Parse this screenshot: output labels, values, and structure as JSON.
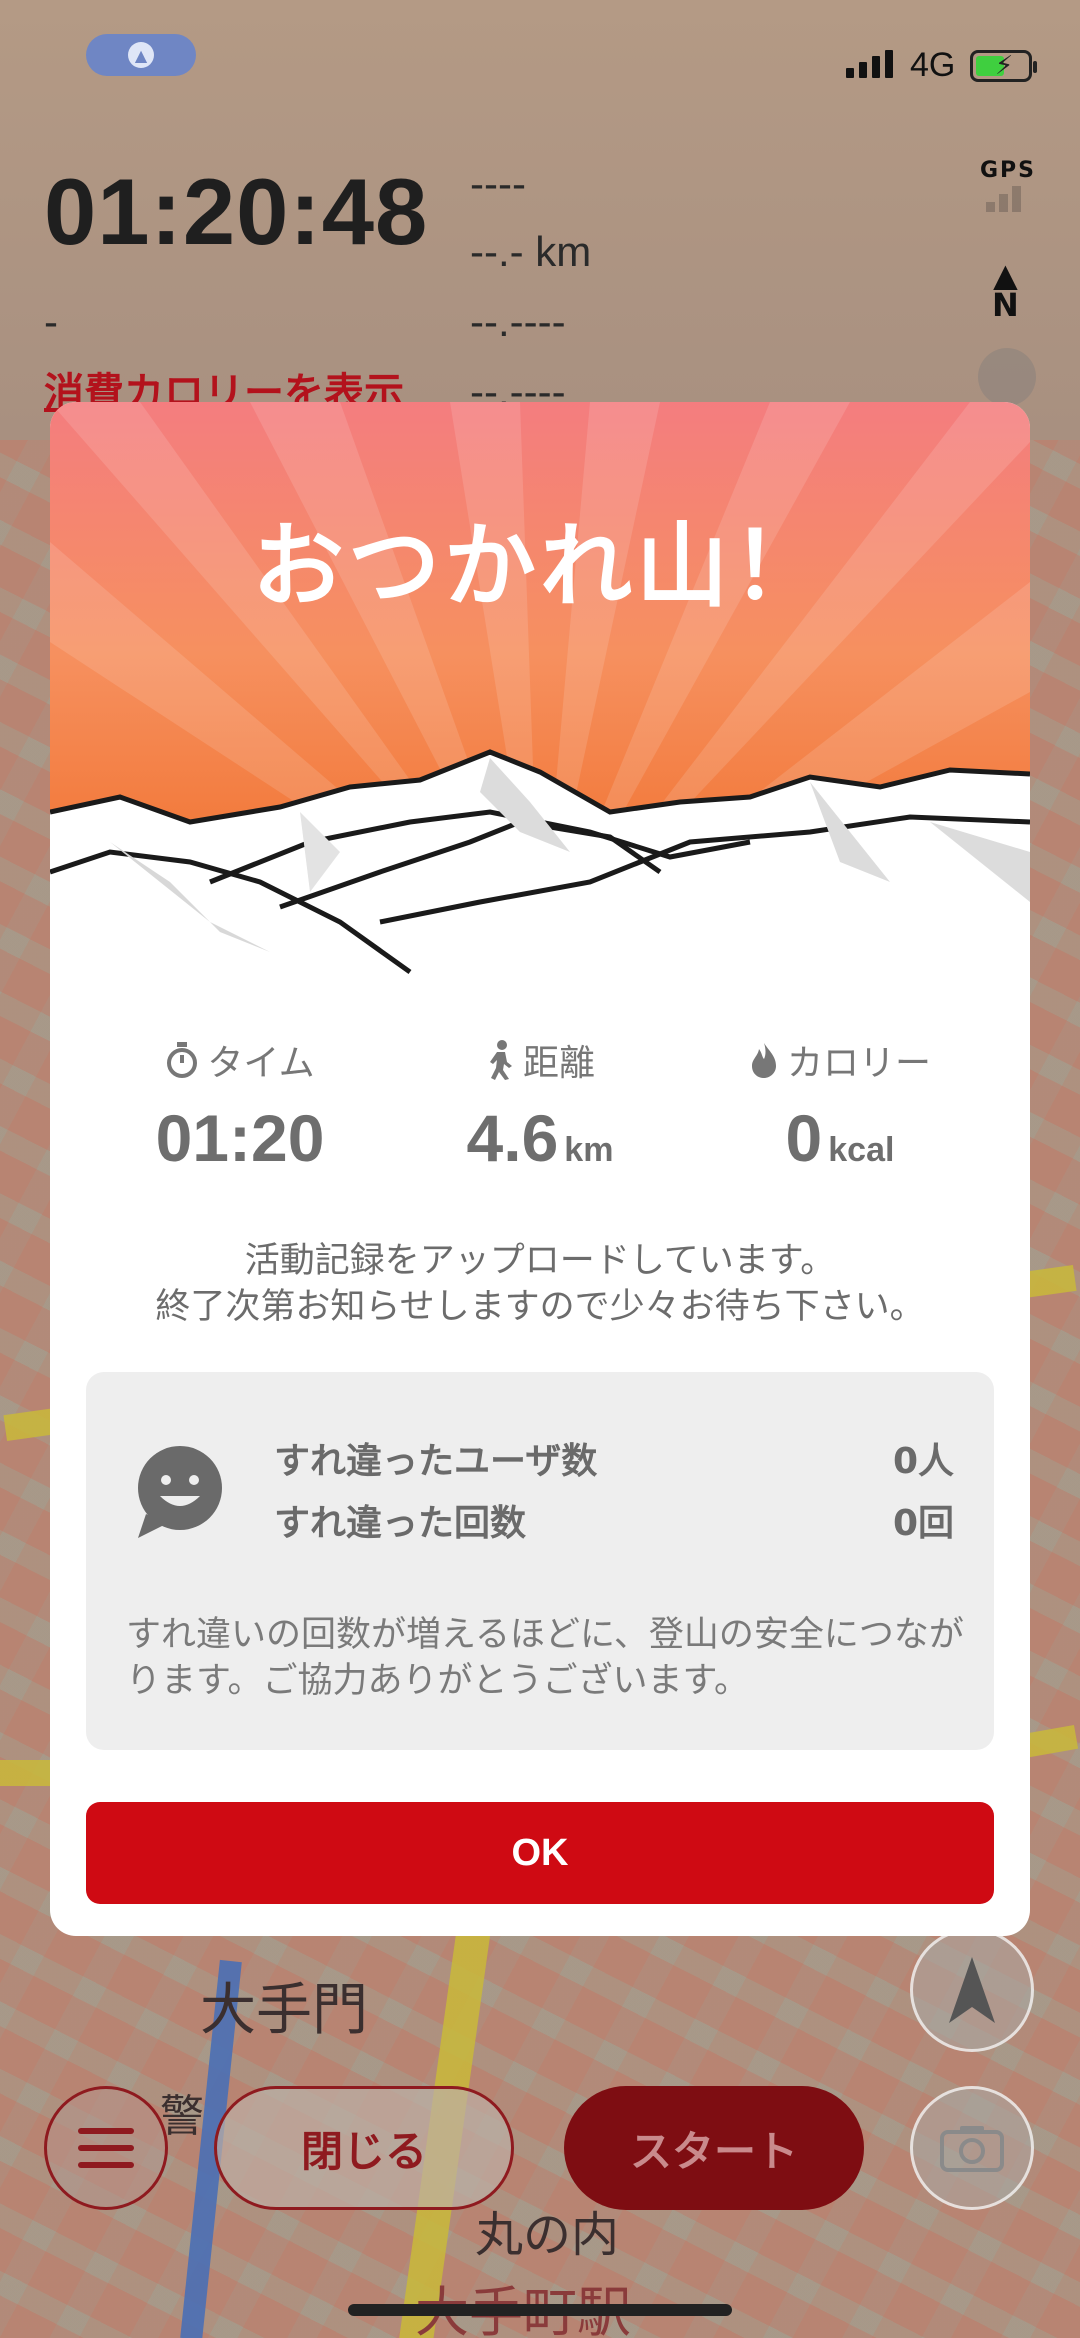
{
  "status_bar": {
    "location_indicator": "navigation-arrow-icon",
    "network": "4G",
    "battery_state": "charging"
  },
  "tracker": {
    "elapsed_time": "01:20:48",
    "line1": "----",
    "distance": "--.- km",
    "left_small": "-",
    "line3": "--.----",
    "line4": "--.----",
    "calorie_link": "消費カロリーを表示",
    "gps_label": "GPS",
    "north_label": "N"
  },
  "dialog": {
    "title": "おつかれ山！",
    "stats": [
      {
        "icon": "stopwatch-icon",
        "label": "タイム",
        "value": "01:20",
        "unit": ""
      },
      {
        "icon": "walker-icon",
        "label": "距離",
        "value": "4.6",
        "unit": "km"
      },
      {
        "icon": "flame-icon",
        "label": "カロリー",
        "value": "0",
        "unit": "kcal"
      }
    ],
    "upload_line1": "活動記録をアップロードしています。",
    "upload_line2": "終了次第お知らせしますので少々お待ち下さい。",
    "passing": {
      "users_label": "すれ違ったユーザ数",
      "users_value": "0人",
      "count_label": "すれ違った回数",
      "count_value": "0回",
      "note": "すれ違いの回数が増えるほどに、登山の安全につながります。ご協力ありがとうございます。"
    },
    "ok_label": "OK"
  },
  "map_labels": [
    "大手門",
    "丸の内",
    "大手町駅",
    "警"
  ],
  "bottom_bar": {
    "menu_icon": "hamburger-menu-icon",
    "close_label": "閉じる",
    "start_label": "スタート",
    "compass_icon": "compass-arrow-icon",
    "camera_icon": "camera-icon"
  },
  "colors": {
    "accent_red": "#cf0a13",
    "hero_orange": "#f47d3a",
    "hero_pink": "#f47d7f"
  }
}
